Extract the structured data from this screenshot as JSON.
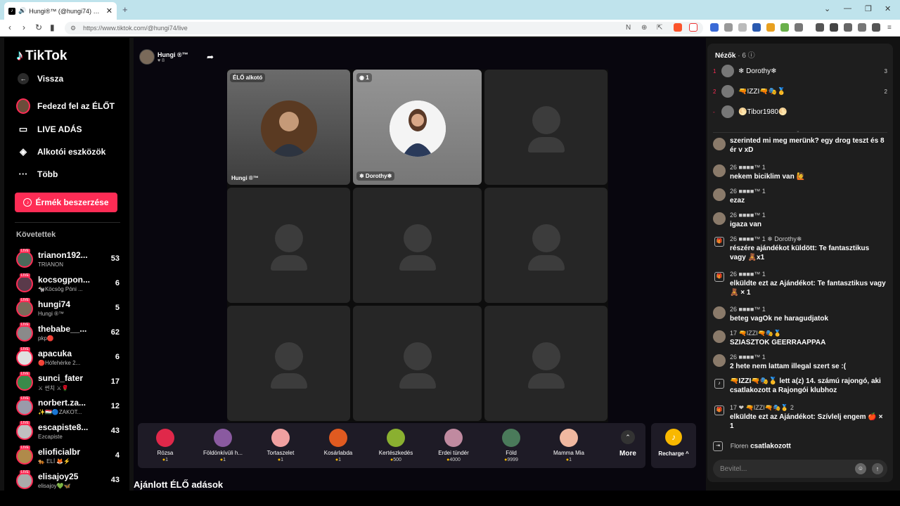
{
  "browser": {
    "tab_title": "Hungi®™ (@hungi74) ÉLŐ a",
    "url": "https://www.tiktok.com/@hungi74/live"
  },
  "sidebar": {
    "logo": "TikTok",
    "back": "Vissza",
    "nav": [
      "Fedezd fel az ÉLŐT",
      "LIVE ADÁS",
      "Alkotói eszközök",
      "Több"
    ],
    "coin_button": "Érmék beszerzése",
    "following_title": "Követettek",
    "following": [
      {
        "name": "trianon192...",
        "sub": "TRIANON",
        "count": "53",
        "color": "#4a6a5a"
      },
      {
        "name": "kocsogpon...",
        "sub": "🐄Köcsög Póni ...",
        "count": "6",
        "color": "#5a3a4a"
      },
      {
        "name": "hungi74",
        "sub": "Hungi ®™",
        "count": "5",
        "color": "#7a6a5a"
      },
      {
        "name": "thebabe__...",
        "sub": "pkp🔴",
        "count": "62",
        "color": "#8a8a8a"
      },
      {
        "name": "apacuka",
        "sub": "🔴Hófehérke 2...",
        "count": "6",
        "color": "#e0e0e0"
      },
      {
        "name": "sunci_fater",
        "sub": "⚔ 썬치 ⚔🌹",
        "count": "17",
        "color": "#3a8a4a"
      },
      {
        "name": "norbert.za...",
        "sub": "✨🇭🇺🔵ZAKOT...",
        "count": "12",
        "color": "#9a9aaa"
      },
      {
        "name": "escapiste8...",
        "sub": "Eꙅcapiste",
        "count": "43",
        "color": "#c0c0c0"
      },
      {
        "name": "elioficialbr",
        "sub": "🐅 ELÍ 🦊⚡",
        "count": "4",
        "color": "#b08a4a"
      },
      {
        "name": "elisajoy25",
        "sub": "elisajoy💚🦋",
        "count": "43",
        "color": "#aaa"
      }
    ]
  },
  "stream": {
    "host_name": "Hungi ®™",
    "host_likes": "♥ 8",
    "host_tag": "ÉLŐ alkotó",
    "host_label": "Hungi ®™",
    "guest_label": "❄ Dorothy❄",
    "guest_count": "◉ 1"
  },
  "gifts": [
    {
      "name": "Rózsa",
      "price": "1",
      "color": "#e0284a"
    },
    {
      "name": "Földönkívüli h...",
      "price": "1",
      "color": "#8a5aa0"
    },
    {
      "name": "Tortaszelet",
      "price": "1",
      "color": "#f0a0a0"
    },
    {
      "name": "Kosárlabda",
      "price": "1",
      "color": "#e05a20"
    },
    {
      "name": "Kertészkedés",
      "price": "500",
      "color": "#8ab030"
    },
    {
      "name": "Erdei tündér",
      "price": "4000",
      "color": "#c08aa0"
    },
    {
      "name": "Föld",
      "price": "9999",
      "color": "#4a7a5a"
    },
    {
      "name": "Mamma Mia",
      "price": "1",
      "color": "#f0b8a0"
    }
  ],
  "more_label": "More",
  "recharge_label": "Recharge ^",
  "recommended": "Ajánlott ÉLŐ adások",
  "viewers": {
    "title": "Nézők",
    "count": "· 6 ⓘ",
    "list": [
      {
        "rank": "1",
        "name": "❄ Dorothy❄",
        "score": "3"
      },
      {
        "rank": "2",
        "name": "🔫IZZI🔫🎭🥇",
        "score": "2"
      },
      {
        "rank": "-",
        "name": "🌕Tibor1980🌕",
        "score": ""
      }
    ]
  },
  "chat": [
    {
      "user": "",
      "text": "szerinted mi meg merünk? egy drog teszt és 8 ér v xD"
    },
    {
      "user": "26 ■■■■™ 1",
      "text": "nekem biciklim van 🙋"
    },
    {
      "user": "26 ■■■■™ 1",
      "text": "ezaz"
    },
    {
      "user": "26 ■■■■™ 1",
      "text": "igaza van"
    },
    {
      "user": "26 ■■■■™ 1 ❄ Dorothy❄",
      "text": "részére ajándékot küldött: Te fantasztikus vagy 🧸x1"
    },
    {
      "user": "26 ■■■■™ 1",
      "text": "elküldte ezt az Ajándékot: Te fantasztikus vagy 🧸 × 1"
    },
    {
      "user": "26 ■■■■™ 1",
      "text": "beteg vagOk ne haragudjatok"
    },
    {
      "user": "17 🔫IZZI🔫🎭🥇",
      "text": "SZIASZTOK GEERRAAPPAA"
    },
    {
      "user": "26 ■■■■™ 1",
      "text": "2 hete nem lattam illegal szert se :("
    },
    {
      "user": "",
      "text": "🔫IZZI🔫🎭🥇 lett a(z) 14. számú rajongó, aki csatlakozott a Rajongói klubhoz"
    },
    {
      "user": "17 ❤ 🔫IZZI🔫🎭🥇 2",
      "text": "elküldte ezt az Ajándékot: Szívlelj engem 🍎 × 1"
    }
  ],
  "joined": {
    "name": "Floren",
    "text": "csatlakozott"
  },
  "input_placeholder": "Bevitel..."
}
